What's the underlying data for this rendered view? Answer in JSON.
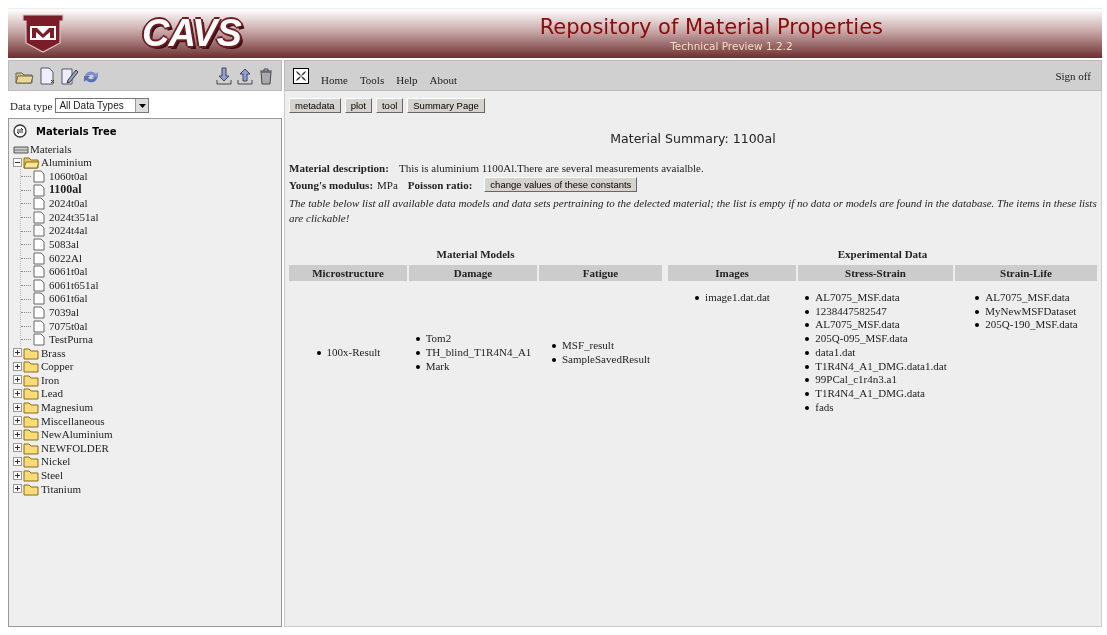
{
  "header": {
    "logo_text": "CAVS",
    "title": "Repository of Material Properties",
    "subtitle": "Technical Preview 1.2.2"
  },
  "data_type": {
    "label": "Data type",
    "value": "All Data Types"
  },
  "tree": {
    "title": "Materials Tree",
    "root": {
      "kind": "root",
      "label": "Materials",
      "expanded": true,
      "children": [
        {
          "kind": "folder",
          "label": "Aluminium",
          "expanded": true,
          "children": [
            {
              "kind": "file",
              "label": "1060t0al",
              "selected": false
            },
            {
              "kind": "file",
              "label": "1100al",
              "selected": true
            },
            {
              "kind": "file",
              "label": "2024t0al",
              "selected": false
            },
            {
              "kind": "file",
              "label": "2024t351al",
              "selected": false
            },
            {
              "kind": "file",
              "label": "2024t4al",
              "selected": false
            },
            {
              "kind": "file",
              "label": "5083al",
              "selected": false
            },
            {
              "kind": "file",
              "label": "6022Al",
              "selected": false
            },
            {
              "kind": "file",
              "label": "6061t0al",
              "selected": false
            },
            {
              "kind": "file",
              "label": "6061t651al",
              "selected": false
            },
            {
              "kind": "file",
              "label": "6061t6al",
              "selected": false
            },
            {
              "kind": "file",
              "label": "7039al",
              "selected": false
            },
            {
              "kind": "file",
              "label": "7075t0al",
              "selected": false
            },
            {
              "kind": "file",
              "label": "TestPurna",
              "selected": false
            }
          ]
        },
        {
          "kind": "folder",
          "label": "Brass",
          "expanded": false
        },
        {
          "kind": "folder",
          "label": "Copper",
          "expanded": false
        },
        {
          "kind": "folder",
          "label": "Iron",
          "expanded": false
        },
        {
          "kind": "folder",
          "label": "Lead",
          "expanded": false
        },
        {
          "kind": "folder",
          "label": "Magnesium",
          "expanded": false
        },
        {
          "kind": "folder",
          "label": "Miscellaneous",
          "expanded": false
        },
        {
          "kind": "folder",
          "label": "NewAluminium",
          "expanded": false
        },
        {
          "kind": "folder",
          "label": "NEWFOLDER",
          "expanded": false
        },
        {
          "kind": "folder",
          "label": "Nickel",
          "expanded": false
        },
        {
          "kind": "folder",
          "label": "Steel",
          "expanded": false
        },
        {
          "kind": "folder",
          "label": "Titanium",
          "expanded": false
        }
      ]
    }
  },
  "nav": {
    "menu": [
      "Home",
      "Tools",
      "Help",
      "About"
    ],
    "sign_off": "Sign off"
  },
  "buttons": [
    "metadata",
    "plot",
    "tool",
    "Summary Page"
  ],
  "summary": {
    "title": "Material Summary: 1100al",
    "description_label": "Material description:",
    "description": "This is aluminium 1100Al.There are several measurements avaialble.",
    "youngs_label": "Young's modulus:",
    "youngs_unit": "MPa",
    "poisson_label": "Poisson ratio:",
    "change_button": "change values of these constants",
    "note": "The table below list all available data models and data sets pertraining to the delected material; the list is empty if no data or models are found in the database. The items in these lists are clickable!"
  },
  "groups": [
    {
      "title": "Material Models",
      "columns": [
        {
          "heading": "Microstructure",
          "items": [
            "100x-Result"
          ]
        },
        {
          "heading": "Damage",
          "items": [
            "Tom2",
            "TH_blind_T1R4N4_A1",
            "Mark"
          ]
        },
        {
          "heading": "Fatigue",
          "items": [
            "MSF_result",
            "SampleSavedResult"
          ]
        }
      ]
    },
    {
      "title": "Experimental Data",
      "columns": [
        {
          "heading": "Images",
          "items": [
            "image1.dat.dat"
          ]
        },
        {
          "heading": "Stress-Strain",
          "items": [
            "AL7075_MSF.data",
            "1238447582547",
            "AL7075_MSF.data",
            "205Q-095_MSF.data",
            "data1.dat",
            "T1R4N4_A1_DMG.data1.dat",
            "99PCal_c1r4n3.a1",
            "T1R4N4_A1_DMG.data",
            "fads"
          ]
        },
        {
          "heading": "Strain-Life",
          "items": [
            "AL7075_MSF.data",
            "MyNewMSFDataset",
            "205Q-190_MSF.data"
          ]
        }
      ]
    }
  ]
}
